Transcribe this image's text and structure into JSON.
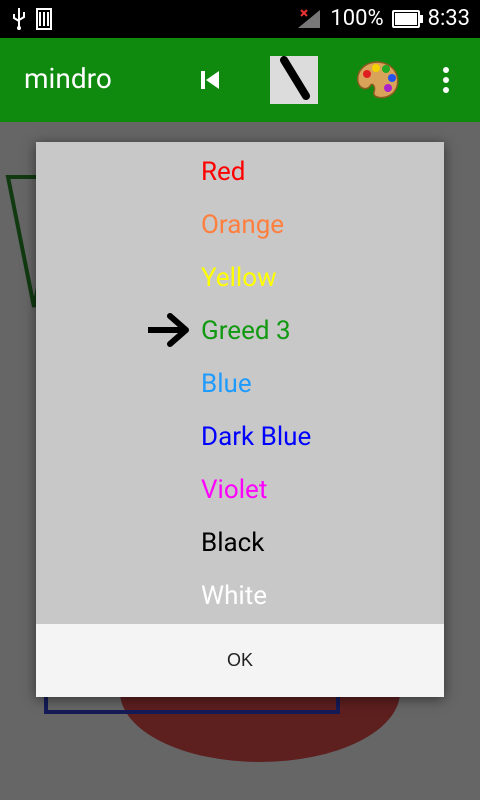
{
  "status_bar": {
    "battery_text": "100%",
    "time": "8:33",
    "icons": [
      "usb-icon",
      "storage-icon",
      "signal-icon",
      "battery-icon"
    ]
  },
  "app_bar": {
    "title": "mindro",
    "actions": [
      "skip-previous-icon",
      "brush-preview",
      "palette-icon",
      "overflow-menu-icon"
    ]
  },
  "dialog": {
    "items": [
      {
        "label": "Red",
        "color": "#ff0000"
      },
      {
        "label": "Orange",
        "color": "#ff7f3f"
      },
      {
        "label": "Yellow",
        "color": "#ffff00"
      },
      {
        "label": "Greed  3",
        "color": "#119911",
        "selected": true
      },
      {
        "label": "Blue",
        "color": "#1e9bff"
      },
      {
        "label": "Dark Blue",
        "color": "#0000ff"
      },
      {
        "label": "Violet",
        "color": "#ff00ff"
      },
      {
        "label": "Black",
        "color": "#000000"
      },
      {
        "label": "White",
        "color": "#ffffff"
      }
    ],
    "ok_label": "OK"
  }
}
